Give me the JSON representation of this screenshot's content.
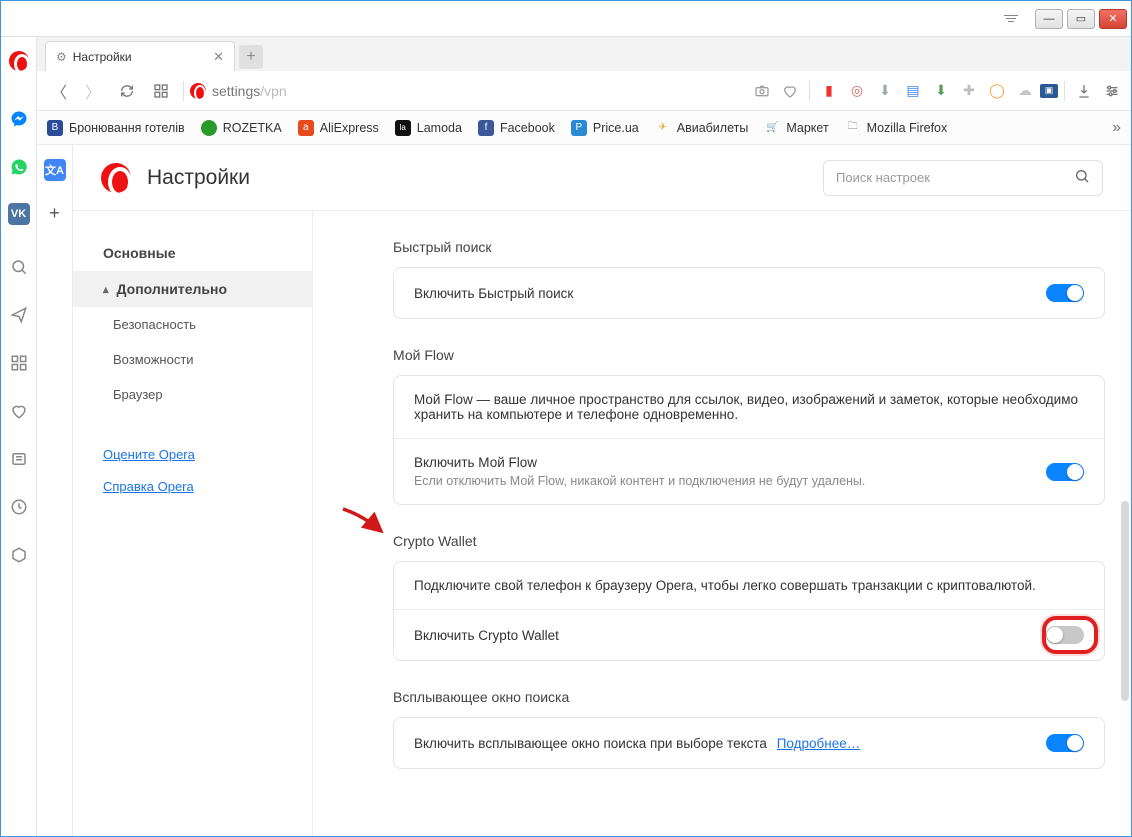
{
  "window": {
    "title": "Opera"
  },
  "tab": {
    "title": "Настройки"
  },
  "address": {
    "url_main": "settings",
    "url_sub": "/vpn"
  },
  "bookmarks": [
    {
      "label": "Бронювання готелів",
      "color": "#2a4a9a",
      "letter": "B"
    },
    {
      "label": "ROZETKA",
      "color": "#2b9a2b",
      "letter": "●"
    },
    {
      "label": "AliExpress",
      "color": "#e84a1d",
      "letter": "a"
    },
    {
      "label": "Lamoda",
      "color": "#111",
      "letter": "la"
    },
    {
      "label": "Facebook",
      "color": "#3b5998",
      "letter": "f"
    },
    {
      "label": "Price.ua",
      "color": "#2a8ad6",
      "letter": "P"
    },
    {
      "label": "Авиабилеты",
      "color": "#f5a623",
      "letter": "✈"
    },
    {
      "label": "Маркет",
      "color": "#ffcc00",
      "letter": "🛒"
    },
    {
      "label": "Mozilla Firefox",
      "color": "transparent",
      "letter": "🗀"
    }
  ],
  "page": {
    "header": "Настройки",
    "search_placeholder": "Поиск настроек"
  },
  "nav": {
    "main": "Основные",
    "advanced": "Дополнительно",
    "security": "Безопасность",
    "features": "Возможности",
    "browser": "Браузер",
    "rate": "Оцените Opera",
    "help": "Справка Opera"
  },
  "sections": {
    "fast_search": {
      "title": "Быстрый поиск",
      "enable": "Включить Быстрый поиск"
    },
    "my_flow": {
      "title": "Мой Flow",
      "desc": "Мой Flow — ваше личное пространство для ссылок, видео, изображений и заметок, которые необходимо хранить на компьютере и телефоне одновременно.",
      "enable": "Включить Мой Flow",
      "enable_sub": "Если отключить Мой Flow, никакой контент и подключения не будут удалены."
    },
    "crypto": {
      "title": "Crypto Wallet",
      "desc": "Подключите свой телефон к браузеру Opera, чтобы легко совершать транзакции с криптовалютой.",
      "enable": "Включить Crypto Wallet"
    },
    "popup": {
      "title": "Всплывающее окно поиска",
      "enable": "Включить всплывающее окно поиска при выборе текста",
      "more": "Подробнее…"
    }
  }
}
